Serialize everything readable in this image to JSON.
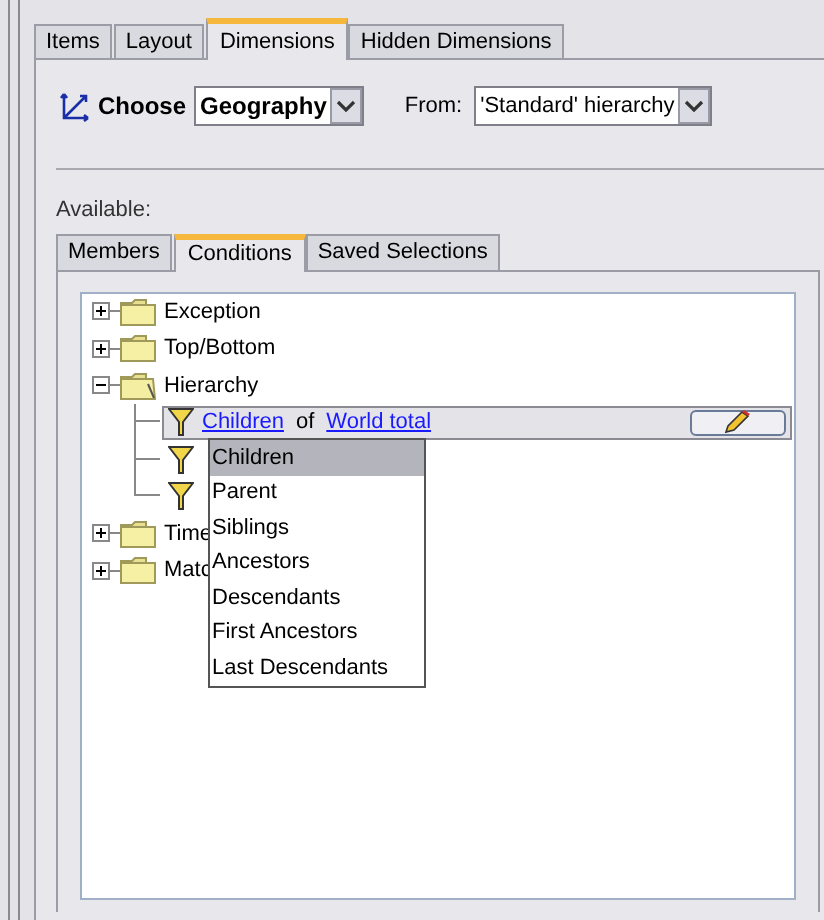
{
  "tabs": [
    {
      "label": "Items",
      "selected": false
    },
    {
      "label": "Layout",
      "selected": false
    },
    {
      "label": "Dimensions",
      "selected": true
    },
    {
      "label": "Hidden Dimensions",
      "selected": false
    }
  ],
  "choose": {
    "label": "Choose",
    "dimension": "Geography",
    "from_label": "From:",
    "hierarchy": "'Standard' hierarchy"
  },
  "available_label": "Available:",
  "inner_tabs": [
    {
      "label": "Members",
      "selected": false
    },
    {
      "label": "Conditions",
      "selected": true
    },
    {
      "label": "Saved Selections",
      "selected": false
    }
  ],
  "tree": [
    {
      "label": "Exception",
      "expanded": false
    },
    {
      "label": "Top/Bottom",
      "expanded": false
    },
    {
      "label": "Hierarchy",
      "expanded": true,
      "children": [
        {
          "selected": true,
          "function": "Children",
          "connector": "of",
          "member": "World total"
        },
        {
          "selected": false
        },
        {
          "selected": false
        }
      ]
    },
    {
      "label": "Time",
      "expanded": false
    },
    {
      "label": "Matc",
      "expanded": false
    }
  ],
  "dropdown": [
    {
      "label": "Children",
      "selected": true
    },
    {
      "label": "Parent",
      "selected": false
    },
    {
      "label": "Siblings",
      "selected": false
    },
    {
      "label": "Ancestors",
      "selected": false
    },
    {
      "label": "Descendants",
      "selected": false
    },
    {
      "label": "First Ancestors",
      "selected": false
    },
    {
      "label": "Last Descendants",
      "selected": false
    }
  ]
}
